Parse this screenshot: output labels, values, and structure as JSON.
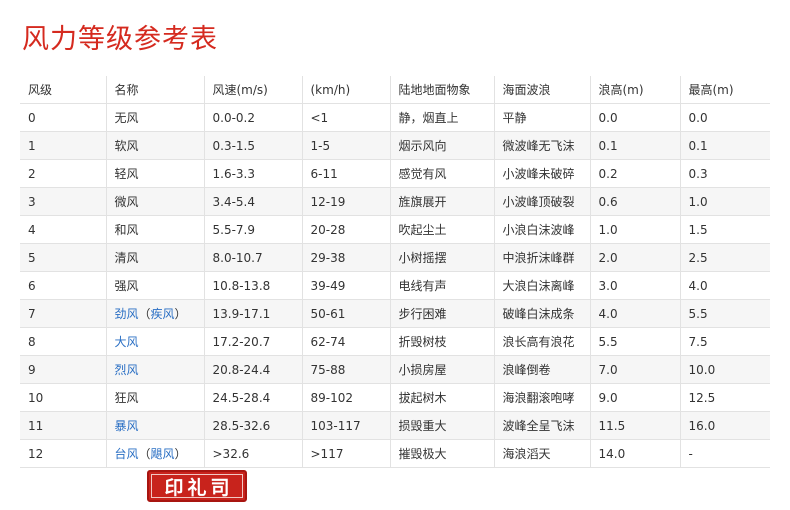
{
  "page": {
    "title": "风力等级参考表"
  },
  "table": {
    "headers": [
      "风级",
      "名称",
      "风速(m/s)",
      "(km/h)",
      "陆地地面物象",
      "海面波浪",
      "浪高(m)",
      "最高(m)"
    ],
    "rows": [
      {
        "level": "0",
        "name": [
          {
            "t": "无风"
          }
        ],
        "ms": "0.0-0.2",
        "kmh": "<1",
        "land": "静，烟直上",
        "sea": "平静",
        "wave": "0.0",
        "max": "0.0"
      },
      {
        "level": "1",
        "name": [
          {
            "t": "软风"
          }
        ],
        "ms": "0.3-1.5",
        "kmh": "1-5",
        "land": "烟示风向",
        "sea": "微波峰无飞沫",
        "wave": "0.1",
        "max": "0.1"
      },
      {
        "level": "2",
        "name": [
          {
            "t": "轻风"
          }
        ],
        "ms": "1.6-3.3",
        "kmh": "6-11",
        "land": "感觉有风",
        "sea": "小波峰未破碎",
        "wave": "0.2",
        "max": "0.3"
      },
      {
        "level": "3",
        "name": [
          {
            "t": "微风"
          }
        ],
        "ms": "3.4-5.4",
        "kmh": "12-19",
        "land": "旌旗展开",
        "sea": "小波峰顶破裂",
        "wave": "0.6",
        "max": "1.0"
      },
      {
        "level": "4",
        "name": [
          {
            "t": "和风"
          }
        ],
        "ms": "5.5-7.9",
        "kmh": "20-28",
        "land": "吹起尘土",
        "sea": "小浪白沫波峰",
        "wave": "1.0",
        "max": "1.5"
      },
      {
        "level": "5",
        "name": [
          {
            "t": "清风"
          }
        ],
        "ms": "8.0-10.7",
        "kmh": "29-38",
        "land": "小树摇摆",
        "sea": "中浪折沫峰群",
        "wave": "2.0",
        "max": "2.5"
      },
      {
        "level": "6",
        "name": [
          {
            "t": "强风"
          }
        ],
        "ms": "10.8-13.8",
        "kmh": "39-49",
        "land": "电线有声",
        "sea": "大浪白沫离峰",
        "wave": "3.0",
        "max": "4.0"
      },
      {
        "level": "7",
        "name": [
          {
            "t": "劲风",
            "link": true
          },
          {
            "t": "（"
          },
          {
            "t": "疾风",
            "link": true
          },
          {
            "t": "）"
          }
        ],
        "ms": "13.9-17.1",
        "kmh": "50-61",
        "land": "步行困难",
        "sea": "破峰白沫成条",
        "wave": "4.0",
        "max": "5.5"
      },
      {
        "level": "8",
        "name": [
          {
            "t": "大风",
            "link": true
          }
        ],
        "ms": "17.2-20.7",
        "kmh": "62-74",
        "land": "折毁树枝",
        "sea": "浪长高有浪花",
        "wave": "5.5",
        "max": "7.5"
      },
      {
        "level": "9",
        "name": [
          {
            "t": "烈风",
            "link": true
          }
        ],
        "ms": "20.8-24.4",
        "kmh": "75-88",
        "land": "小损房屋",
        "sea": "浪峰倒卷",
        "wave": "7.0",
        "max": "10.0"
      },
      {
        "level": "10",
        "name": [
          {
            "t": "狂风"
          }
        ],
        "ms": "24.5-28.4",
        "kmh": "89-102",
        "land": "拔起树木",
        "sea": "海浪翻滚咆哮",
        "wave": "9.0",
        "max": "12.5"
      },
      {
        "level": "11",
        "name": [
          {
            "t": "暴风",
            "link": true
          }
        ],
        "ms": "28.5-32.6",
        "kmh": "103-117",
        "land": "损毁重大",
        "sea": "波峰全呈飞沫",
        "wave": "11.5",
        "max": "16.0"
      },
      {
        "level": "12",
        "name": [
          {
            "t": "台风",
            "link": true
          },
          {
            "t": "（"
          },
          {
            "t": "飓风",
            "link": true
          },
          {
            "t": "）"
          }
        ],
        "ms": ">32.6",
        "kmh": ">117",
        "land": "摧毁极大",
        "sea": "海浪滔天",
        "wave": "14.0",
        "max": "-"
      }
    ]
  },
  "stamp": {
    "text": "印礼司"
  },
  "colors": {
    "title": "#d52a1f",
    "link": "#2a6fc4",
    "stamp": "#c8231c"
  }
}
